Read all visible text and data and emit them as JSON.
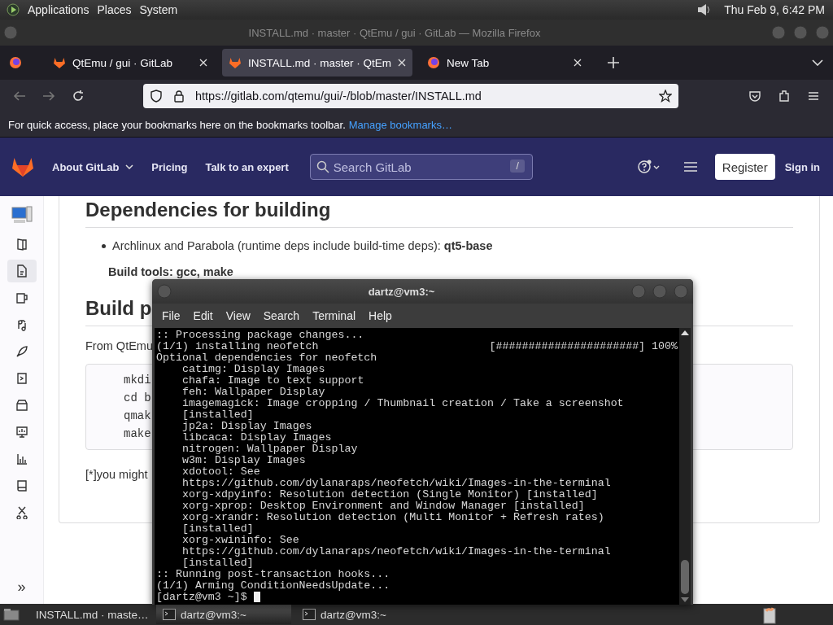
{
  "top_panel": {
    "menus": [
      "Applications",
      "Places",
      "System"
    ],
    "clock": "Thu Feb  9,  6:42 PM"
  },
  "browser": {
    "title": "INSTALL.md · master · QtEmu / gui · GitLab — Mozilla Firefox",
    "tabs": [
      {
        "label": "QtEmu / gui · GitLab",
        "kind": "gitlab",
        "selected": false
      },
      {
        "label": "INSTALL.md · master · QtEm",
        "kind": "gitlab",
        "selected": true
      },
      {
        "label": "New Tab",
        "kind": "firefox",
        "selected": false
      }
    ],
    "url": "https://gitlab.com/qtemu/gui/-/blob/master/INSTALL.md",
    "bookmarks_hint": "For quick access, place your bookmarks here on the bookmarks toolbar.",
    "bookmarks_link": "Manage bookmarks…"
  },
  "gitlab_header": {
    "nav": [
      "About GitLab",
      "Pricing",
      "Talk to an expert"
    ],
    "search_placeholder": "Search GitLab",
    "search_key": "/",
    "register": "Register",
    "sign_in": "Sign in"
  },
  "sidebar": {
    "items": [
      {
        "selected": false
      },
      {
        "selected": true
      },
      {
        "selected": false
      },
      {
        "selected": false
      },
      {
        "selected": false
      },
      {
        "selected": false
      },
      {
        "selected": false
      },
      {
        "selected": false
      },
      {
        "selected": false
      },
      {
        "selected": false
      },
      {
        "selected": false
      }
    ],
    "expand": "»"
  },
  "document": {
    "heading_1": "Dependencies for building",
    "bullet": "Archlinux and Parabola (runtime deps include build-time deps): **qt5-base**",
    "build_tools": "Build tools: gcc, make",
    "heading_2": "Build p",
    "intro": "From QtEmu",
    "code": [
      "mkdi",
      "cd b",
      "qmak",
      "make"
    ],
    "footnote": "[*]you might"
  },
  "terminal": {
    "title": "dartz@vm3:~",
    "menu": [
      "File",
      "Edit",
      "View",
      "Search",
      "Terminal",
      "Help"
    ],
    "lines": [
      {
        "text": ":: Processing package changes...",
        "indent": false
      },
      {
        "text": "(1/1) installing neofetch",
        "indent": false,
        "progress": "[######################] 100%"
      },
      {
        "text": "Optional dependencies for neofetch",
        "indent": false
      },
      {
        "text": "catimg: Display Images",
        "indent": true
      },
      {
        "text": "chafa: Image to text support",
        "indent": true
      },
      {
        "text": "feh: Wallpaper Display",
        "indent": true
      },
      {
        "text": "imagemagick: Image cropping / Thumbnail creation / Take a screenshot",
        "indent": true
      },
      {
        "text": "[installed]",
        "indent": true
      },
      {
        "text": "jp2a: Display Images",
        "indent": true
      },
      {
        "text": "libcaca: Display Images",
        "indent": true
      },
      {
        "text": "nitrogen: Wallpaper Display",
        "indent": true
      },
      {
        "text": "w3m: Display Images",
        "indent": true
      },
      {
        "text": "xdotool: See",
        "indent": true
      },
      {
        "text": "https://github.com/dylanaraps/neofetch/wiki/Images-in-the-terminal",
        "indent": true
      },
      {
        "text": "xorg-xdpyinfo: Resolution detection (Single Monitor) [installed]",
        "indent": true
      },
      {
        "text": "xorg-xprop: Desktop Environment and Window Manager [installed]",
        "indent": true
      },
      {
        "text": "xorg-xrandr: Resolution detection (Multi Monitor + Refresh rates)",
        "indent": true
      },
      {
        "text": "[installed]",
        "indent": true
      },
      {
        "text": "xorg-xwininfo: See",
        "indent": true
      },
      {
        "text": "https://github.com/dylanaraps/neofetch/wiki/Images-in-the-terminal",
        "indent": true
      },
      {
        "text": "[installed]",
        "indent": true
      },
      {
        "text": ":: Running post-transaction hooks...",
        "indent": false
      },
      {
        "text": "(1/1) Arming ConditionNeedsUpdate...",
        "indent": false
      }
    ],
    "prompt": "[dartz@vm3 ~]$"
  },
  "taskbar": {
    "items": [
      {
        "label": "INSTALL.md · maste…",
        "kind": "firefox",
        "selected": false
      },
      {
        "label": "dartz@vm3:~",
        "kind": "terminal",
        "selected": true
      },
      {
        "label": "dartz@vm3:~",
        "kind": "terminal",
        "selected": false
      }
    ]
  }
}
